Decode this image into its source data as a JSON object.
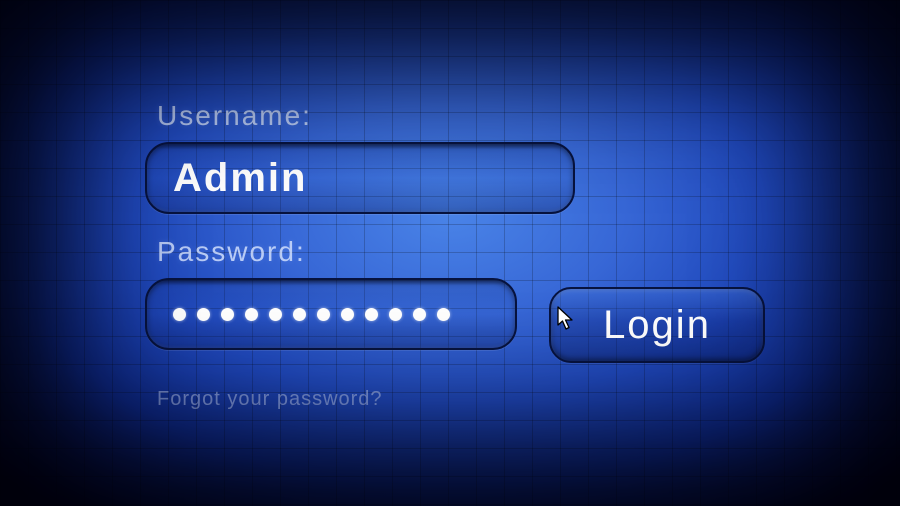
{
  "form": {
    "username_label": "Username:",
    "username_value": "Admin",
    "password_label": "Password:",
    "password_dot_count": 12,
    "forgot_link": "Forgot your password?"
  },
  "actions": {
    "login_label": "Login"
  }
}
